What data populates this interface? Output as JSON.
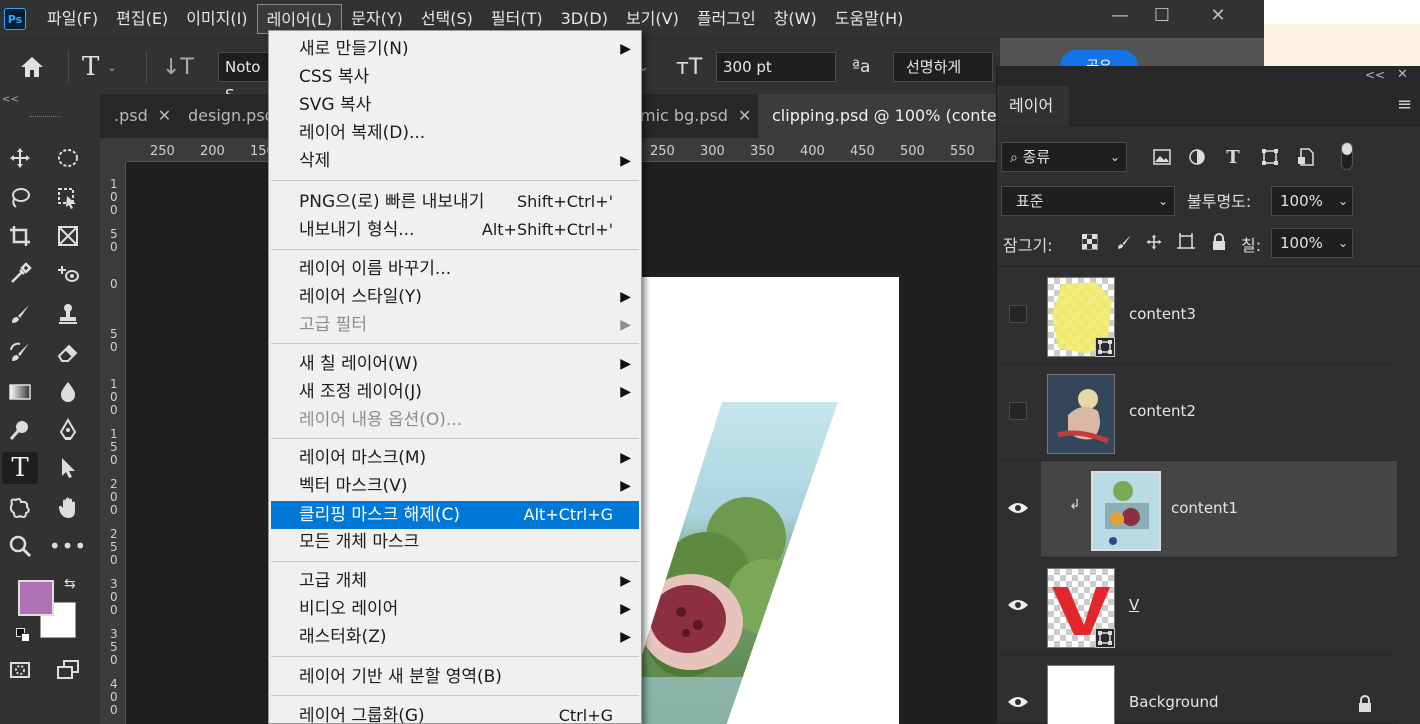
{
  "app": {
    "logo": "Ps"
  },
  "menubar": {
    "items": [
      "파일(F)",
      "편집(E)",
      "이미지(I)",
      "레이어(L)",
      "문자(Y)",
      "선택(S)",
      "필터(T)",
      "3D(D)",
      "보기(V)",
      "플러그인",
      "창(W)",
      "도움말(H)"
    ],
    "active": "레이어(L)"
  },
  "window_controls": {
    "minimize": "—",
    "maximize": "☐",
    "close": "✕"
  },
  "options_bar": {
    "font_family": "Noto S",
    "font_size": "300 pt",
    "aa_symbol": "ªa",
    "anti_alias": "선명하게",
    "share_label": "공유"
  },
  "tabs": [
    {
      "label": ".psd",
      "close": "✕"
    },
    {
      "label": "design.psd",
      "close": ""
    },
    {
      "label": "mic bg.psd",
      "close": "✕"
    },
    {
      "label": "clipping.psd @ 100% (content",
      "close": ""
    }
  ],
  "ruler_top": [
    "250",
    "200",
    "150",
    "250",
    "300",
    "350",
    "400",
    "450",
    "500",
    "550"
  ],
  "ruler_left": [
    "1\n0\n0",
    "5\n0",
    "0",
    "5\n0",
    "1\n0\n0",
    "1\n5\n0",
    "2\n0\n0",
    "2\n5\n0",
    "3\n0\n0",
    "3\n5\n0",
    "4\n0\n0"
  ],
  "tools_header": "<<",
  "colors": {
    "foreground": "#b072b4",
    "background": "#ffffff",
    "highlight": "#0078d7",
    "share": "#1473e6"
  },
  "layer_menu": {
    "items": [
      {
        "label": "새로 만들기(N)",
        "shortcut": "",
        "submenu": true,
        "disabled": false
      },
      {
        "label": "CSS 복사",
        "shortcut": "",
        "submenu": false,
        "disabled": false
      },
      {
        "label": "SVG 복사",
        "shortcut": "",
        "submenu": false,
        "disabled": false
      },
      {
        "label": "레이어 복제(D)...",
        "shortcut": "",
        "submenu": false,
        "disabled": false
      },
      {
        "label": "삭제",
        "shortcut": "",
        "submenu": true,
        "disabled": false
      },
      {
        "label": "PNG으(로) 빠른 내보내기",
        "shortcut": "Shift+Ctrl+'",
        "submenu": false,
        "disabled": false
      },
      {
        "label": "내보내기 형식...",
        "shortcut": "Alt+Shift+Ctrl+'",
        "submenu": false,
        "disabled": false
      },
      {
        "label": "레이어 이름 바꾸기...",
        "shortcut": "",
        "submenu": false,
        "disabled": false
      },
      {
        "label": "레이어 스타일(Y)",
        "shortcut": "",
        "submenu": true,
        "disabled": false
      },
      {
        "label": "고급 필터",
        "shortcut": "",
        "submenu": true,
        "disabled": true
      },
      {
        "label": "새 칠 레이어(W)",
        "shortcut": "",
        "submenu": true,
        "disabled": false
      },
      {
        "label": "새 조정 레이어(J)",
        "shortcut": "",
        "submenu": true,
        "disabled": false
      },
      {
        "label": "레이어 내용 옵션(O)...",
        "shortcut": "",
        "submenu": false,
        "disabled": true
      },
      {
        "label": "레이어 마스크(M)",
        "shortcut": "",
        "submenu": true,
        "disabled": false
      },
      {
        "label": "벡터 마스크(V)",
        "shortcut": "",
        "submenu": true,
        "disabled": false
      },
      {
        "label": "클리핑 마스크 해제(C)",
        "shortcut": "Alt+Ctrl+G",
        "submenu": false,
        "disabled": false,
        "highlighted": true
      },
      {
        "label": "모든 개체 마스크",
        "shortcut": "",
        "submenu": false,
        "disabled": false
      },
      {
        "label": "고급 개체",
        "shortcut": "",
        "submenu": true,
        "disabled": false
      },
      {
        "label": "비디오 레이어",
        "shortcut": "",
        "submenu": true,
        "disabled": false
      },
      {
        "label": "래스터화(Z)",
        "shortcut": "",
        "submenu": true,
        "disabled": false
      },
      {
        "label": "레이어 기반 새 분할 영역(B)",
        "shortcut": "",
        "submenu": false,
        "disabled": false
      },
      {
        "label": "레이어 그룹화(G)",
        "shortcut": "Ctrl+G",
        "submenu": false,
        "disabled": false
      }
    ]
  },
  "layers_panel": {
    "collapse": "<<",
    "close": "✕",
    "tab_label": "레이어",
    "menu_icon": "≡",
    "filter_kind": "종류",
    "blend_mode": "표준",
    "opacity_label": "불투명도:",
    "opacity_value": "100%",
    "lock_label": "잠그기:",
    "fill_label": "칠:",
    "fill_value": "100%",
    "layers": [
      {
        "name": "content3",
        "visible": false,
        "selected": false,
        "clipped": false,
        "smart": true,
        "locked": false
      },
      {
        "name": "content2",
        "visible": false,
        "selected": false,
        "clipped": false,
        "smart": false,
        "locked": false
      },
      {
        "name": "content1",
        "visible": true,
        "selected": true,
        "clipped": true,
        "smart": false,
        "locked": false
      },
      {
        "name": "V",
        "visible": true,
        "selected": false,
        "clipped": false,
        "smart": true,
        "locked": false
      },
      {
        "name": "Background",
        "visible": true,
        "selected": false,
        "clipped": false,
        "smart": false,
        "locked": true
      }
    ]
  }
}
